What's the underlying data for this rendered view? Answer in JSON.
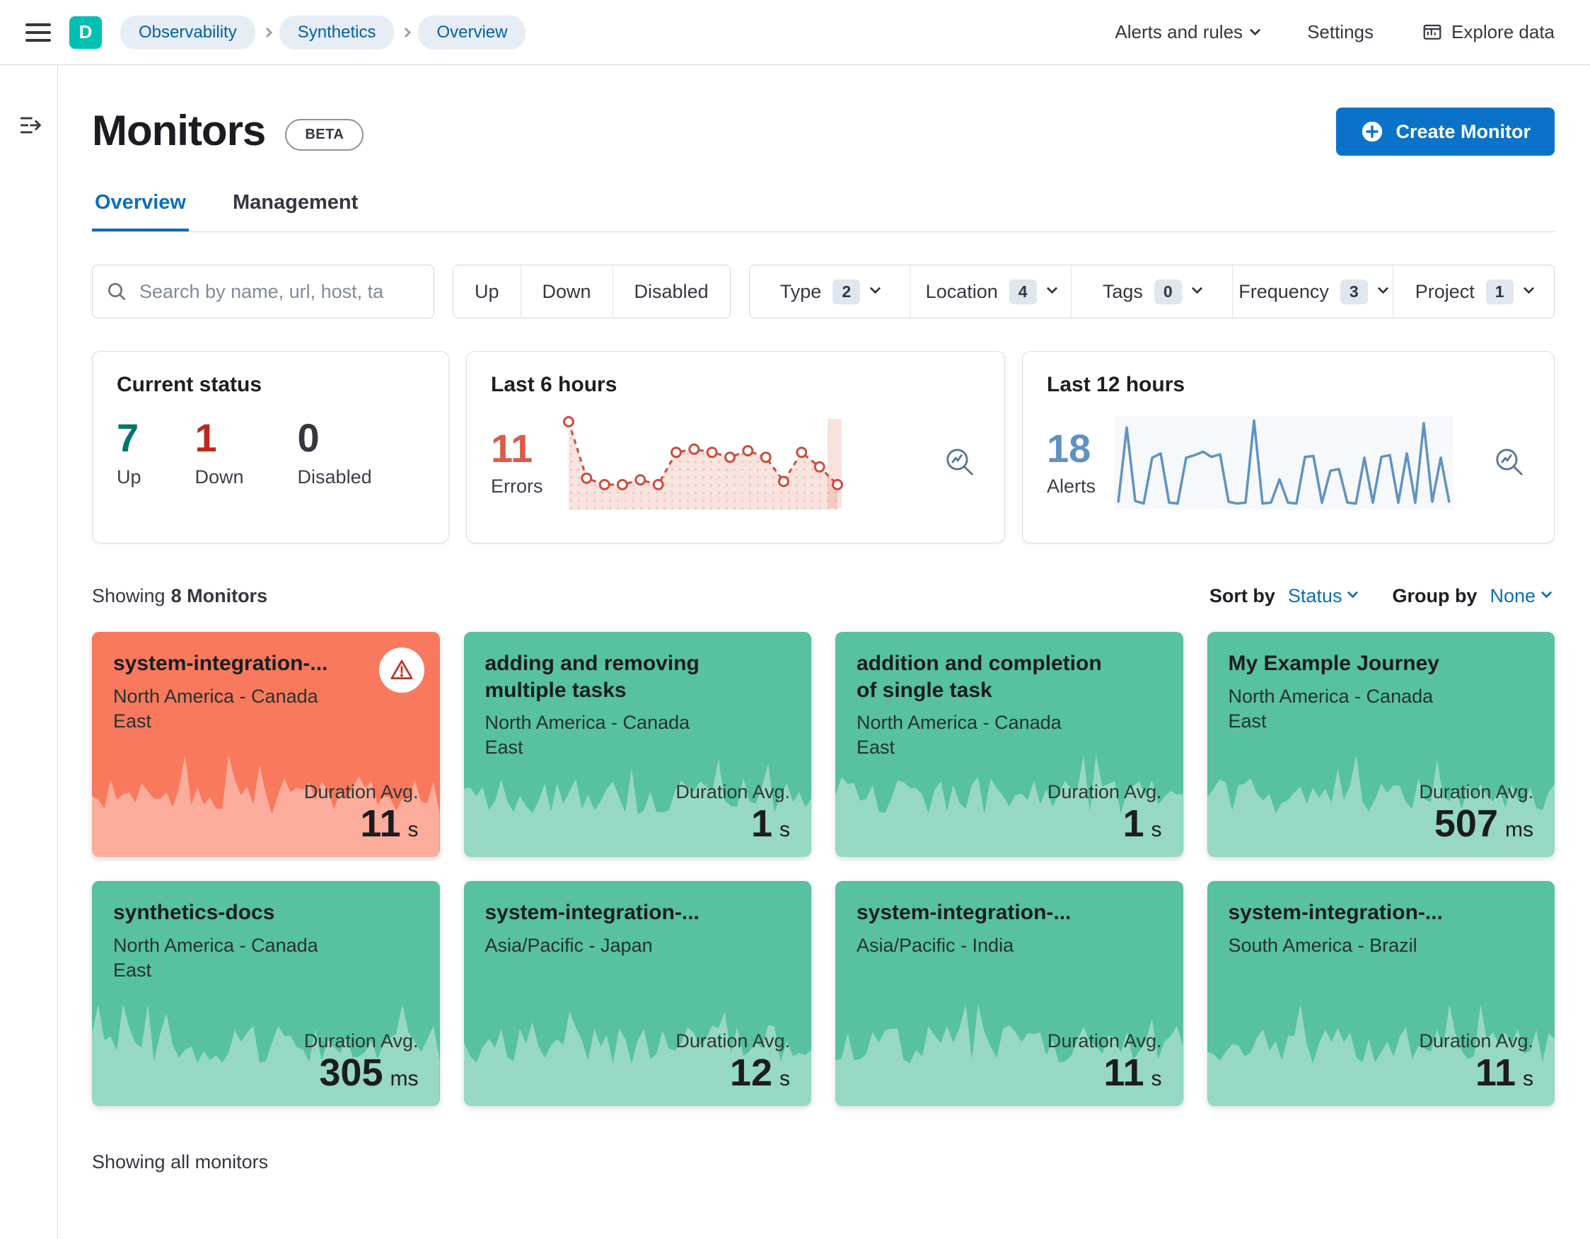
{
  "topbar": {
    "logo_letter": "D",
    "breadcrumbs": [
      "Observability",
      "Synthetics",
      "Overview"
    ],
    "alerts_menu": "Alerts and rules",
    "settings": "Settings",
    "explore": "Explore data"
  },
  "page": {
    "title": "Monitors",
    "beta_badge": "BETA",
    "create_button": "Create Monitor",
    "tabs": [
      {
        "label": "Overview",
        "active": true
      },
      {
        "label": "Management",
        "active": false
      }
    ],
    "showing_prefix": "Showing",
    "showing_count": "8 Monitors",
    "sort_by_label": "Sort by",
    "sort_by_value": "Status",
    "group_by_label": "Group by",
    "group_by_value": "None",
    "footer": "Showing all monitors"
  },
  "filters": {
    "search_placeholder": "Search by name, url, host, ta",
    "status_buttons": [
      "Up",
      "Down",
      "Disabled"
    ],
    "facets": [
      {
        "label": "Type",
        "count": "2"
      },
      {
        "label": "Location",
        "count": "4"
      },
      {
        "label": "Tags",
        "count": "0"
      },
      {
        "label": "Frequency",
        "count": "3"
      },
      {
        "label": "Project",
        "count": "1"
      }
    ]
  },
  "stats": {
    "current_status": {
      "title": "Current status",
      "items": [
        {
          "value": "7",
          "label": "Up",
          "color": "#00756b"
        },
        {
          "value": "1",
          "label": "Down",
          "color": "#bd271e"
        },
        {
          "value": "0",
          "label": "Disabled",
          "color": "#343741"
        }
      ]
    },
    "last6": {
      "title": "Last 6 hours",
      "value": "11",
      "label": "Errors",
      "color": "#d95c49",
      "spark": [
        10,
        3,
        2.2,
        2.2,
        2.8,
        2.2,
        6.2,
        6.6,
        6.2,
        5.6,
        6.4,
        5.6,
        2.6,
        6.2,
        4.4,
        2.2
      ]
    },
    "last12": {
      "title": "Last 12 hours",
      "value": "18",
      "label": "Alerts",
      "color": "#6092c0",
      "spark": [
        0.3,
        9,
        0.5,
        0.2,
        5.5,
        6,
        0.3,
        0.2,
        5.5,
        5.8,
        6.2,
        5.6,
        5.9,
        0.4,
        0.2,
        0.3,
        9.8,
        0.2,
        0.3,
        3,
        0.3,
        0.2,
        5.6,
        5.7,
        0.3,
        4,
        4.2,
        0.3,
        0.2,
        5.5,
        0.3,
        5.6,
        5.8,
        0.3,
        6,
        0.3,
        9.5,
        0.4,
        5.5,
        0.3
      ]
    }
  },
  "misc": {
    "duration_label": "Duration Avg."
  },
  "monitors": [
    {
      "name": "system-integration-...",
      "location": "North America - Canada East",
      "duration_value": "11",
      "duration_unit": "s",
      "status": "down"
    },
    {
      "name": "adding and removing multiple tasks",
      "location": "North America - Canada East",
      "duration_value": "1",
      "duration_unit": "s",
      "status": "up"
    },
    {
      "name": "addition and completion of single task",
      "location": "North America - Canada East",
      "duration_value": "1",
      "duration_unit": "s",
      "status": "up"
    },
    {
      "name": "My Example Journey",
      "location": "North America - Canada East",
      "duration_value": "507",
      "duration_unit": "ms",
      "status": "up"
    },
    {
      "name": "synthetics-docs",
      "location": "North America - Canada East",
      "duration_value": "305",
      "duration_unit": "ms",
      "status": "up"
    },
    {
      "name": "system-integration-...",
      "location": "Asia/Pacific - Japan",
      "duration_value": "12",
      "duration_unit": "s",
      "status": "up"
    },
    {
      "name": "system-integration-...",
      "location": "Asia/Pacific - India",
      "duration_value": "11",
      "duration_unit": "s",
      "status": "up"
    },
    {
      "name": "system-integration-...",
      "location": "South America - Brazil",
      "duration_value": "11",
      "duration_unit": "s",
      "status": "up"
    }
  ]
}
